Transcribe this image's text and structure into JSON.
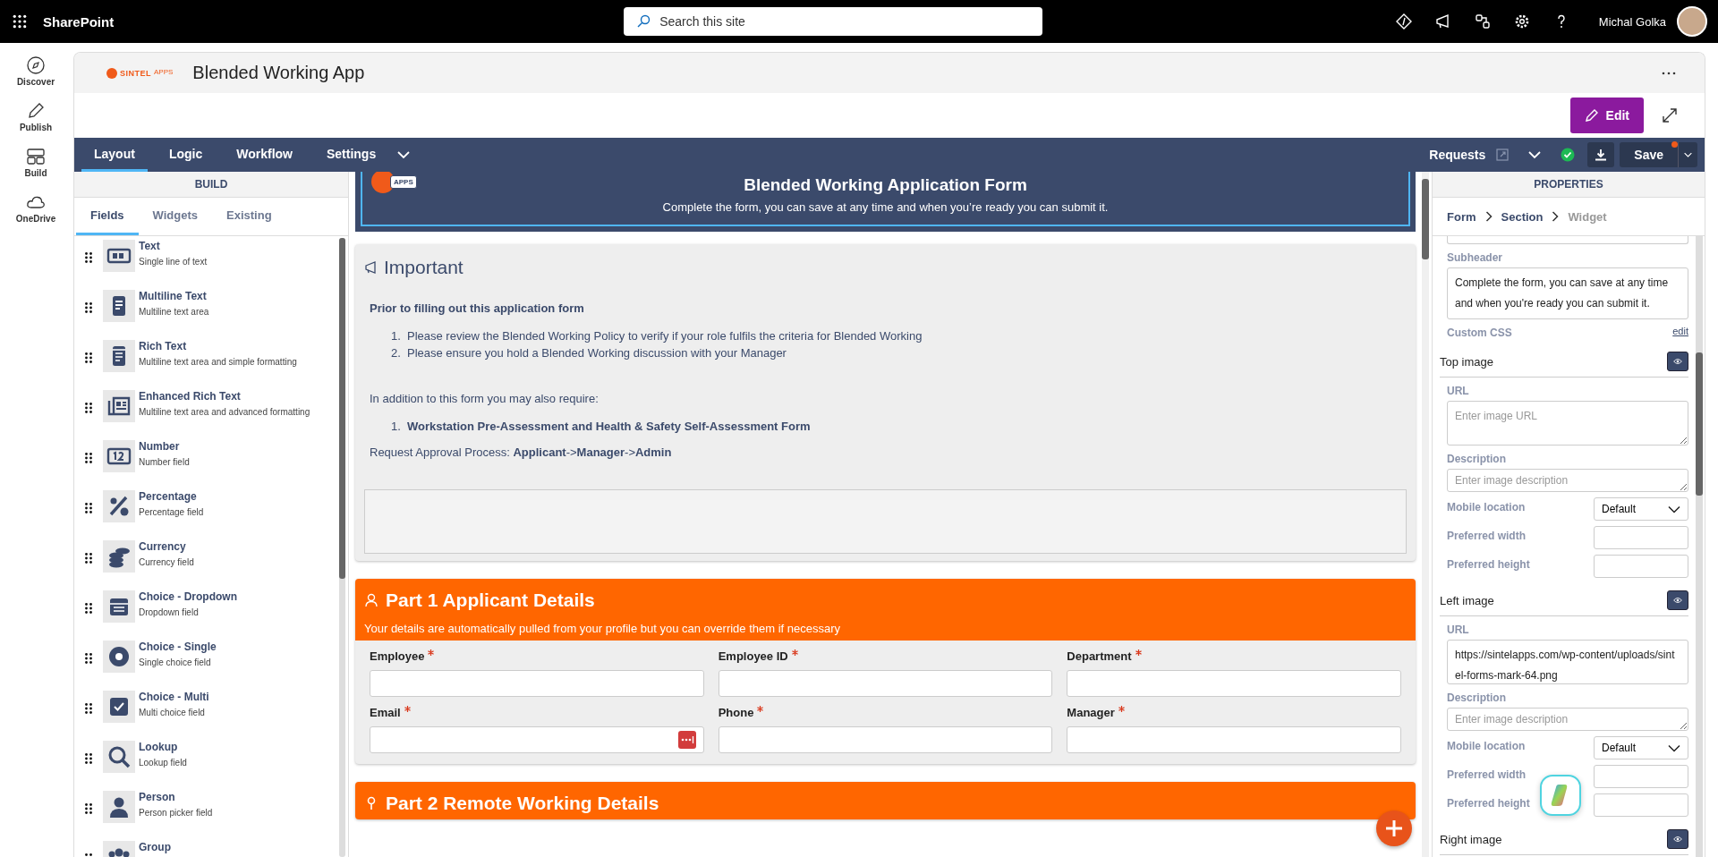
{
  "topbar": {
    "app_name": "SharePoint",
    "search_placeholder": "Search this site",
    "user_name": "Michal Golka"
  },
  "rail": [
    {
      "label": "Discover",
      "kind": "compass"
    },
    {
      "label": "Publish",
      "kind": "pen"
    },
    {
      "label": "Build",
      "kind": "grid"
    },
    {
      "label": "OneDrive",
      "kind": "cloud"
    }
  ],
  "app": {
    "logo_text": "SINTEL",
    "logo_sup": "APPS",
    "title": "Blended Working App",
    "edit_button": "Edit"
  },
  "nav": {
    "tabs": [
      {
        "label": "Layout",
        "selected": true
      },
      {
        "label": "Logic",
        "selected": false
      },
      {
        "label": "Workflow",
        "selected": false
      },
      {
        "label": "Settings",
        "selected": false
      }
    ],
    "requests_label": "Requests",
    "save_button": "Save",
    "unsaved": true
  },
  "build_panel": {
    "title": "BUILD",
    "tabs": [
      {
        "label": "Fields",
        "selected": true
      },
      {
        "label": "Widgets",
        "selected": false
      },
      {
        "label": "Existing",
        "selected": false
      }
    ],
    "items": [
      {
        "name": "Text",
        "description": "Single line of text",
        "kind": "text"
      },
      {
        "name": "Multiline Text",
        "description": "Multiline text area",
        "kind": "multiline"
      },
      {
        "name": "Rich Text",
        "description": "Multiline text area and simple formatting",
        "kind": "rich"
      },
      {
        "name": "Enhanced Rich Text",
        "description": "Multiline text area and advanced formatting",
        "kind": "enhanced"
      },
      {
        "name": "Number",
        "description": "Number field",
        "kind": "number"
      },
      {
        "name": "Percentage",
        "description": "Percentage field",
        "kind": "percentage"
      },
      {
        "name": "Currency",
        "description": "Currency field",
        "kind": "currency"
      },
      {
        "name": "Choice - Dropdown",
        "description": "Dropdown field",
        "kind": "dropdown"
      },
      {
        "name": "Choice - Single",
        "description": "Single choice field",
        "kind": "single"
      },
      {
        "name": "Choice - Multi",
        "description": "Multi choice field",
        "kind": "multi"
      },
      {
        "name": "Lookup",
        "description": "Lookup field",
        "kind": "lookup"
      },
      {
        "name": "Person",
        "description": "Person picker field",
        "kind": "person"
      },
      {
        "name": "Group",
        "kind": "group"
      }
    ]
  },
  "form": {
    "header": {
      "logo_text": "APPS",
      "title": "Blended Working Application Form",
      "subtitle": "Complete the form, you can save at any time and when you’re ready you can submit it."
    },
    "important": {
      "title": "Important",
      "lead": "Prior to filling out this application form",
      "steps": [
        {
          "number": "1.",
          "text": "Please review the Blended Working Policy to verify if your role fulfils the criteria for Blended Working"
        },
        {
          "number": "2.",
          "text": "Please ensure you hold a Blended Working discussion with your Manager"
        }
      ],
      "intro": "In addition to this form you may also require:",
      "requirements": [
        {
          "number": "1.",
          "text": "Workstation Pre-Assessment and Health & Safety Self-Assessment Form"
        }
      ],
      "process": "Request Approval Process: **Applicant**->**Manager**->**Admin**"
    },
    "sections": [
      {
        "title": "Part 1 Applicant Details",
        "kind": "person",
        "subtitle": "Your details are automatically pulled from your profile but you can override them if necessary",
        "fields": [
          {
            "label": "Employee",
            "required": true,
            "autofill": false
          },
          {
            "label": "Employee ID",
            "required": true,
            "autofill": false
          },
          {
            "label": "Department",
            "required": true,
            "autofill": false
          },
          {
            "label": "Email",
            "required": true,
            "autofill": true
          },
          {
            "label": "Phone",
            "required": true,
            "autofill": false
          },
          {
            "label": "Manager",
            "required": true,
            "autofill": false
          }
        ]
      },
      {
        "title": "Part 2 Remote Working Details",
        "kind": "pin"
      }
    ]
  },
  "properties": {
    "title": "PROPERTIES",
    "breadcrumb": [
      {
        "label": "Form",
        "disabled": false
      },
      {
        "label": "Section",
        "disabled": false
      },
      {
        "label": "Widget",
        "disabled": true
      }
    ],
    "subheader_label": "Subheader",
    "subheader_value": "Complete the form, you can save at any time and when you're ready you can submit it.",
    "custom_css_label": "Custom CSS",
    "custom_css_link": "edit",
    "images": [
      {
        "title": "Top image",
        "url_label": "URL",
        "url": {
          "placeholder": "Enter image URL"
        },
        "description_label": "Description",
        "description": {
          "placeholder": "Enter image description"
        },
        "mobile_location_label": "Mobile location",
        "mobile_location": "Default",
        "width_label": "Preferred width",
        "height_label": "Preferred height"
      },
      {
        "title": "Left image",
        "url_label": "URL",
        "url": {
          "value": "https://sintelapps.com/wp-content/uploads/sintel-forms-mark-64.png"
        },
        "description_label": "Description",
        "description": {
          "placeholder": "Enter image description"
        },
        "mobile_location_label": "Mobile location",
        "mobile_location": "Default",
        "width_label": "Preferred width",
        "height_label": "Preferred height"
      },
      {
        "title": "Right image"
      }
    ]
  }
}
